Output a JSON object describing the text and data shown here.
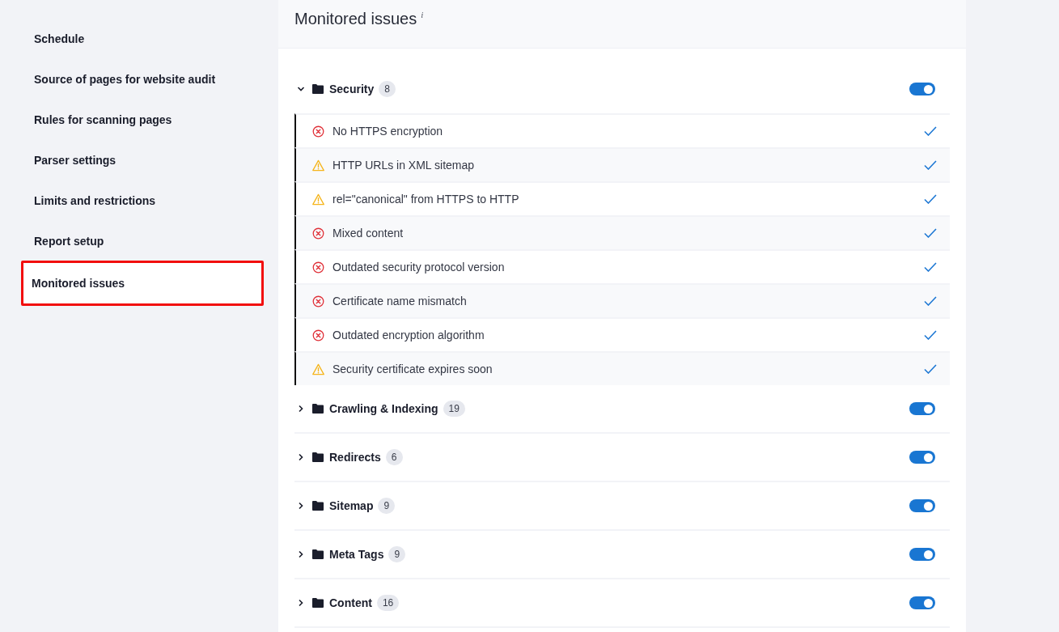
{
  "sidebar": {
    "items": [
      {
        "label": "Schedule",
        "selected": false
      },
      {
        "label": "Source of pages for website audit",
        "selected": false
      },
      {
        "label": "Rules for scanning pages",
        "selected": false
      },
      {
        "label": "Parser settings",
        "selected": false
      },
      {
        "label": "Limits and restrictions",
        "selected": false
      },
      {
        "label": "Report setup",
        "selected": false
      },
      {
        "label": "Monitored issues",
        "selected": true
      }
    ]
  },
  "panel": {
    "title": "Monitored issues",
    "info_mark": "i"
  },
  "groups": [
    {
      "name": "Security",
      "count": "8",
      "expanded": true,
      "on": true,
      "issues": [
        {
          "label": "No HTTPS encryption",
          "kind": "error",
          "checked": true
        },
        {
          "label": "HTTP URLs in XML sitemap",
          "kind": "warning",
          "checked": true
        },
        {
          "label": "rel=\"canonical\" from HTTPS to HTTP",
          "kind": "warning",
          "checked": true
        },
        {
          "label": "Mixed content",
          "kind": "error",
          "checked": true
        },
        {
          "label": "Outdated security protocol version",
          "kind": "error",
          "checked": true
        },
        {
          "label": "Certificate name mismatch",
          "kind": "error",
          "checked": true
        },
        {
          "label": "Outdated encryption algorithm",
          "kind": "error",
          "checked": true
        },
        {
          "label": "Security certificate expires soon",
          "kind": "warning",
          "checked": true
        }
      ]
    },
    {
      "name": "Crawling & Indexing",
      "count": "19",
      "expanded": false,
      "on": true
    },
    {
      "name": "Redirects",
      "count": "6",
      "expanded": false,
      "on": true
    },
    {
      "name": "Sitemap",
      "count": "9",
      "expanded": false,
      "on": true
    },
    {
      "name": "Meta Tags",
      "count": "9",
      "expanded": false,
      "on": true
    },
    {
      "name": "Content",
      "count": "16",
      "expanded": false,
      "on": true
    }
  ]
}
